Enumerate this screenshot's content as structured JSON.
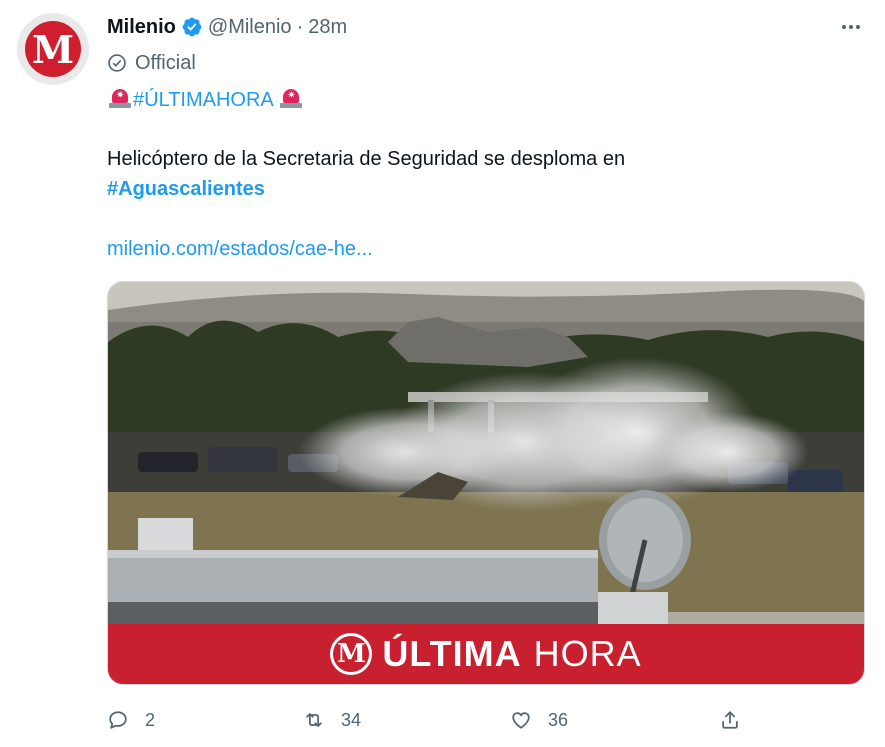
{
  "tweet": {
    "author_name": "Milenio",
    "handle": "@Milenio",
    "separator": "·",
    "time": "28m",
    "official_label": "Official",
    "avatar_letter": "M",
    "hashtag_headline": "#ÚLTIMAHORA",
    "body_text": "Helicóptero de la Secretaria de Seguridad se desploma en",
    "hashtag_location": "#Aguascalientes",
    "link_text": "milenio.com/estados/cae-he..."
  },
  "media": {
    "banner_logo": "M",
    "banner_title_bold": "ÚLTIMA",
    "banner_title_light": "HORA"
  },
  "actions": {
    "reply_count": "2",
    "retweet_count": "34",
    "like_count": "36"
  },
  "icons": {
    "verified": "verified-badge-icon",
    "official": "official-check-icon",
    "siren": "rotating-light-icon",
    "more": "more-dots-icon",
    "reply": "reply-icon",
    "retweet": "retweet-icon",
    "like": "heart-icon",
    "share": "share-icon"
  },
  "colors": {
    "link": "#1d9bf0",
    "secondary_text": "#536471",
    "brand_red": "#c8202e",
    "primary_text": "#0f1419"
  }
}
